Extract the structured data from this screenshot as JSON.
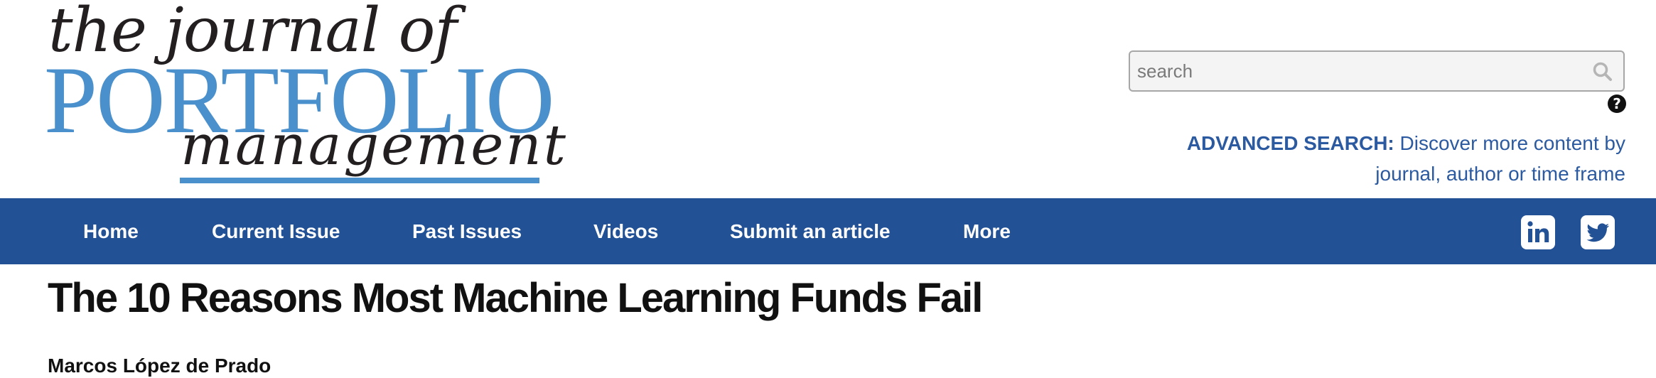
{
  "logo": {
    "line1": "the journal of",
    "line2": "PORTFOLIO",
    "line3": "management"
  },
  "search": {
    "placeholder": "search",
    "value": "",
    "icon": "search-icon",
    "help_icon": "question-circle-icon",
    "help_glyph": "?"
  },
  "advanced_search": {
    "label": "ADVANCED SEARCH:",
    "text": " Discover more content by journal, author or time frame"
  },
  "nav": {
    "items": [
      {
        "label": "Home"
      },
      {
        "label": "Current Issue"
      },
      {
        "label": "Past Issues"
      },
      {
        "label": "Videos"
      },
      {
        "label": "Submit an article"
      },
      {
        "label": "More"
      }
    ],
    "social": [
      {
        "name": "linkedin-icon"
      },
      {
        "name": "twitter-icon"
      }
    ]
  },
  "article": {
    "title": "The 10 Reasons Most Machine Learning Funds Fail",
    "author": "Marcos López de Prado"
  },
  "colors": {
    "brand_blue": "#4a90cd",
    "nav_blue": "#235195",
    "link_blue": "#2c5aa0",
    "text_dark": "#111111"
  }
}
